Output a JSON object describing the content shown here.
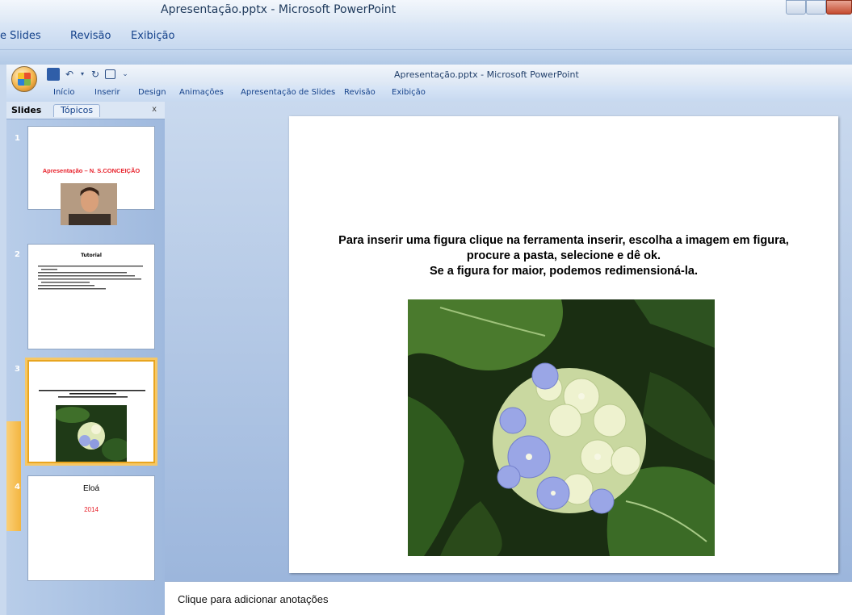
{
  "outer_window": {
    "title": "Apresentação.pptx - Microsoft PowerPoint",
    "tabs": [
      "e Slides",
      "Revisão",
      "Exibição"
    ]
  },
  "window": {
    "title": "Apresentação.pptx - Microsoft PowerPoint"
  },
  "ribbon_tabs": [
    "Início",
    "Inserir",
    "Design",
    "Animações",
    "Apresentação de Slides",
    "Revisão",
    "Exibição"
  ],
  "slides_pane": {
    "tabs": [
      "Slides",
      "Tópicos"
    ],
    "close": "x",
    "thumbnails": [
      {
        "number": "1",
        "title": "Apresentação – N. S.CONCEIÇÃO"
      },
      {
        "number": "2",
        "title": "Tutorial"
      },
      {
        "number": "3",
        "title": ""
      },
      {
        "number": "4",
        "title": "Eloá",
        "subtitle": "2014"
      }
    ]
  },
  "slide": {
    "lines": [
      "Para inserir uma figura clique na ferramenta inserir, escolha  a imagem em figura,",
      "procure a pasta, selecione  e dê ok.",
      "Se a figura for maior, podemos redimensioná-la."
    ]
  },
  "notes": {
    "placeholder": "Clique para adicionar anotações"
  },
  "colors": {
    "title_red": "#e8202a",
    "selection_orange": "#f3b540",
    "ribbon_text": "#15428b"
  }
}
